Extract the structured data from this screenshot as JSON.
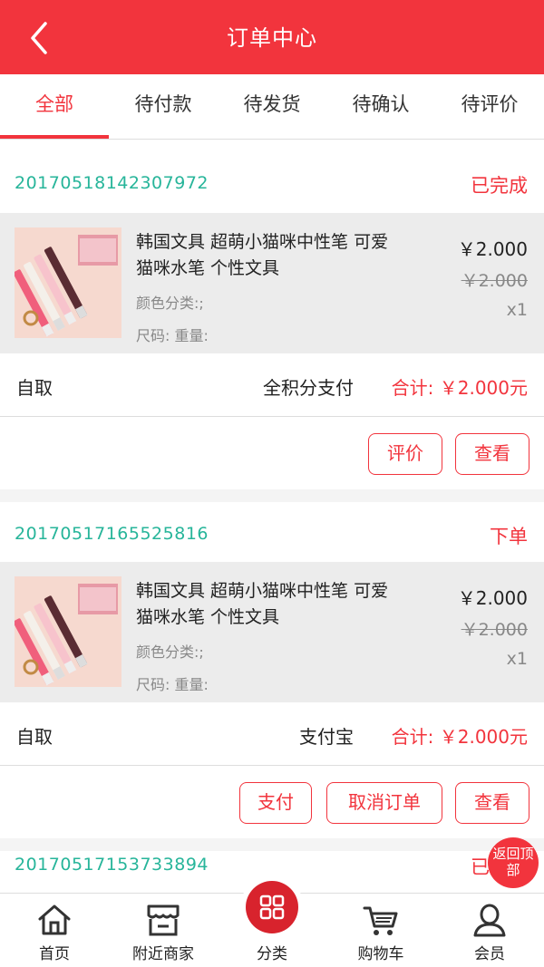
{
  "header": {
    "title": "订单中心"
  },
  "tabs": [
    {
      "label": "全部",
      "active": true
    },
    {
      "label": "待付款",
      "active": false
    },
    {
      "label": "待发货",
      "active": false
    },
    {
      "label": "待确认",
      "active": false
    },
    {
      "label": "待评价",
      "active": false
    }
  ],
  "orders": [
    {
      "order_no": "20170518142307972",
      "status": "已完成",
      "item": {
        "name": "韩国文具 超萌小猫咪中性笔 可爱猫咪水笔 个性文具",
        "attr_color": "颜色分类:;",
        "attr_size": "尺码: 重量:",
        "price": "￥2.000",
        "original_price": "￥2.000",
        "qty": "x1"
      },
      "pickup": "自取",
      "pay_method": "全积分支付",
      "total": "合计: ￥2.000元",
      "buttons": [
        "评价",
        "查看"
      ]
    },
    {
      "order_no": "20170517165525816",
      "status": "下单",
      "item": {
        "name": "韩国文具 超萌小猫咪中性笔 可爱猫咪水笔 个性文具",
        "attr_color": "颜色分类:;",
        "attr_size": "尺码: 重量:",
        "price": "￥2.000",
        "original_price": "￥2.000",
        "qty": "x1"
      },
      "pickup": "自取",
      "pay_method": "支付宝",
      "total": "合计: ￥2.000元",
      "buttons": [
        "支付",
        "取消订单",
        "查看"
      ]
    },
    {
      "order_no": "20170517153733894",
      "status": "已完成"
    }
  ],
  "back_to_top": "返回顶部",
  "tabbar": [
    {
      "label": "首页",
      "icon": "home-icon"
    },
    {
      "label": "附近商家",
      "icon": "store-icon"
    },
    {
      "label": "分类",
      "icon": "category-grid-icon"
    },
    {
      "label": "购物车",
      "icon": "cart-icon"
    },
    {
      "label": "会员",
      "icon": "user-icon"
    }
  ],
  "colors": {
    "accent": "#f2343d",
    "order_no": "#27b59a"
  }
}
